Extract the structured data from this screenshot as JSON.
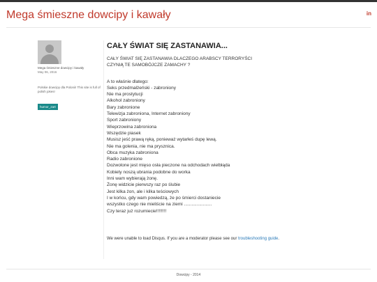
{
  "site": {
    "title": "Mega śmieszne dowcipy i kawały",
    "social_label": "in"
  },
  "sidebar": {
    "author": "Mega śmieszne dowcipy i kawały",
    "date": "May 06, 2016",
    "description": "Polskie dowcipy dla Polonii! This site is full of polish jokes!",
    "tag": "humor_zart"
  },
  "post": {
    "title": "CAŁY ŚWIAT SIĘ ZASTANAWIA...",
    "intro_1": "CAŁY ŚWIAT SIĘ ZASTANAWIA DLACZEGO ARABSCY TERRORYŚCI",
    "intro_2": "CZYNIĄ TE SAMOBÓJCZE ZAMACHY ?",
    "lines": [
      "A to właśnie dlatego:",
      "Seks przedmałżeński - zabroniony",
      "Nie ma prostytucji",
      "Alkohol zabroniony",
      "Bary zabronione",
      "Telewizja zabroniona, Internet zabroniony",
      "Sport zabroniony",
      "Wieprzowina zabroniona",
      "Wszędzie piasek",
      "Musisz jeść prawą ręką, ponieważ wytarłeś dupę lewą.",
      "Nie ma golenia, nie ma prysznica.",
      "Obca muzyka zabroniona",
      "Radio zabronione",
      "Dozwolone jest mięso osła pieczone na odchodach wielbłąda",
      "Kobiety noszą ubrania podobne do worka",
      "Inni wam wybierają żonę.",
      "Żonę widzicie pierwszy raz po ślubie",
      "Jest kilka żon, ale i kilka teściowych",
      "I w końcu, gdy wam powiedzą, że po śmierci dostaniecie",
      "wszystko czego nie mieliście na ziemi ......................",
      "Czy teraz już rozumiecie!!!!!!!!"
    ]
  },
  "disqus": {
    "text": "We were unable to load Disqus. If you are a moderator please see our ",
    "link": "troubleshooting guide",
    "end": "."
  },
  "footer": {
    "text": "Dowcipy - 2014"
  }
}
